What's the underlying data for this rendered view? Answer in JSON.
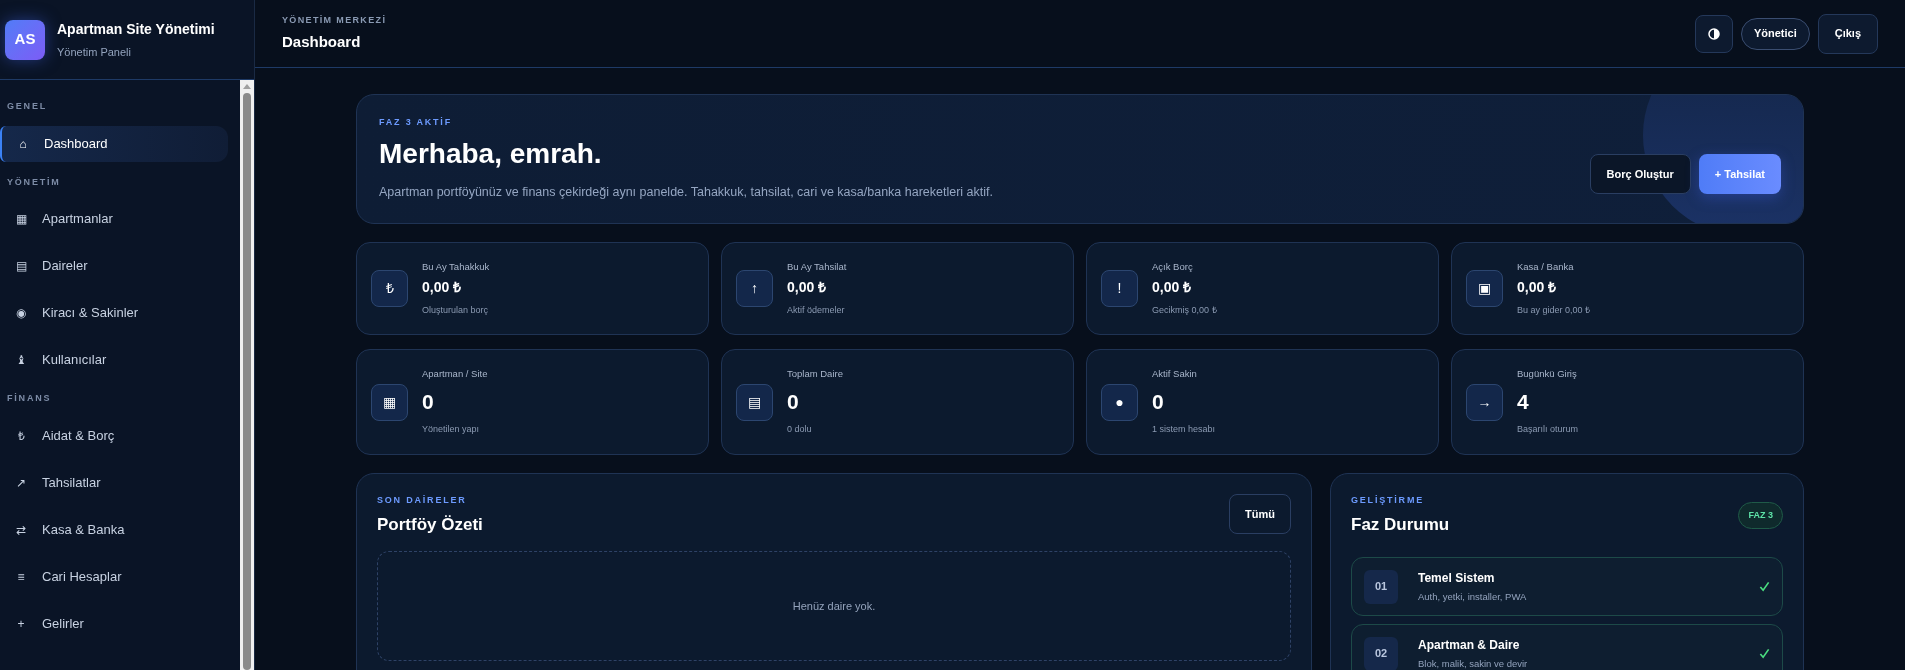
{
  "brand": {
    "logo": "AS",
    "title": "Apartman Site Yönetimi",
    "subtitle": "Yönetim Paneli"
  },
  "sidebar": {
    "sections": [
      {
        "label": "GENEL",
        "items": [
          {
            "icon": "⌂",
            "label": "Dashboard",
            "selected": true
          }
        ]
      },
      {
        "label": "YÖNETİM",
        "items": [
          {
            "icon": "▦",
            "label": "Apartmanlar",
            "selected": false
          },
          {
            "icon": "▤",
            "label": "Daireler",
            "selected": false
          },
          {
            "icon": "◉",
            "label": "Kiracı & Sakinler",
            "selected": false
          },
          {
            "icon": "♝",
            "label": "Kullanıcılar",
            "selected": false
          }
        ]
      },
      {
        "label": "FİNANS",
        "items": [
          {
            "icon": "₺",
            "label": "Aidat & Borç",
            "selected": false
          },
          {
            "icon": "↗",
            "label": "Tahsilatlar",
            "selected": false
          },
          {
            "icon": "⇄",
            "label": "Kasa & Banka",
            "selected": false
          },
          {
            "icon": "≡",
            "label": "Cari Hesaplar",
            "selected": false
          },
          {
            "icon": "+",
            "label": "Gelirler",
            "selected": false
          }
        ]
      }
    ]
  },
  "header": {
    "eyebrow": "YÖNETİM MERKEZİ",
    "title": "Dashboard",
    "role": "Yönetici",
    "logout": "Çıkış"
  },
  "hero": {
    "eyebrow": "FAZ 3 AKTİF",
    "title": "Merhaba, emrah.",
    "text": "Apartman portföyünüz ve finans çekirdeği aynı panelde. Tahakkuk, tahsilat, cari ve kasa/banka hareketleri aktif.",
    "buttons": [
      {
        "label": "Borç Oluştur",
        "kind": "secondary"
      },
      {
        "label": "+ Tahsilat",
        "kind": "primary"
      }
    ]
  },
  "stats": [
    {
      "icon": "₺",
      "label": "Bu Ay Tahakkuk",
      "value": "0,00 ₺",
      "note": "Oluşturulan borç",
      "kind": "money"
    },
    {
      "icon": "↑",
      "label": "Bu Ay Tahsilat",
      "value": "0,00 ₺",
      "note": "Aktif ödemeler",
      "kind": "money"
    },
    {
      "icon": "!",
      "label": "Açık Borç",
      "value": "0,00 ₺",
      "note": "Gecikmiş 0,00 ₺",
      "kind": "money"
    },
    {
      "icon": "▣",
      "label": "Kasa / Banka",
      "value": "0,00 ₺",
      "note": "Bu ay gider 0,00 ₺",
      "kind": "money"
    },
    {
      "icon": "▦",
      "label": "Apartman / Site",
      "value": "0",
      "note": "Yönetilen yapı",
      "kind": "count"
    },
    {
      "icon": "▤",
      "label": "Toplam Daire",
      "value": "0",
      "note": "0 dolu",
      "kind": "count"
    },
    {
      "icon": "●",
      "label": "Aktif Sakin",
      "value": "0",
      "note": "1 sistem hesabı",
      "kind": "count"
    },
    {
      "icon": "→",
      "label": "Bugünkü Giriş",
      "value": "4",
      "note": "Başarılı oturum",
      "kind": "count"
    }
  ],
  "portfolio": {
    "eyebrow": "SON DAİRELER",
    "title": "Portföy Özeti",
    "button": "Tümü",
    "empty": "Henüz daire yok."
  },
  "phases": {
    "eyebrow": "GELİŞTİRME",
    "title": "Faz Durumu",
    "badge": "FAZ 3",
    "items": [
      {
        "number": "01",
        "title": "Temel Sistem",
        "text": "Auth, yetki, installer, PWA",
        "done": true
      },
      {
        "number": "02",
        "title": "Apartman & Daire",
        "text": "Blok, malik, sakin ve devir",
        "done": true
      }
    ]
  }
}
